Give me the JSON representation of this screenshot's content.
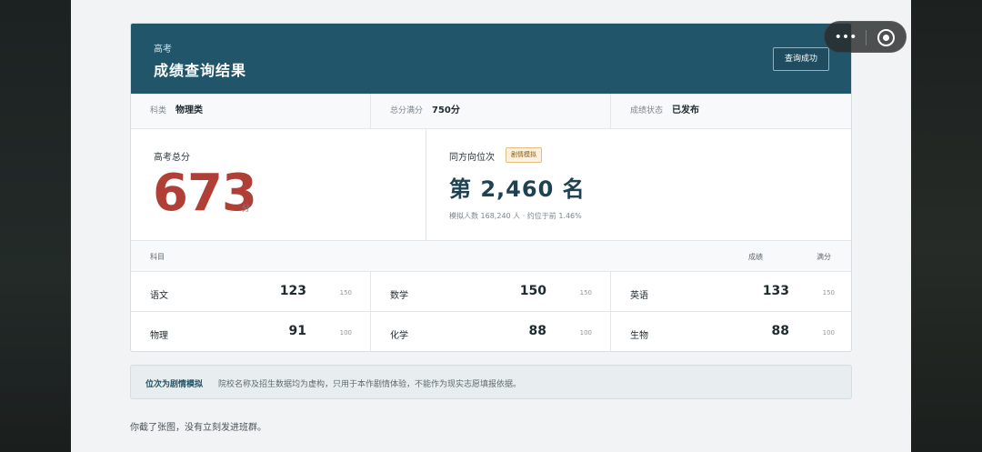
{
  "header": {
    "eyebrow": "高考",
    "title": "成绩查询结果",
    "status_button": "查询成功"
  },
  "info": [
    {
      "key": "科类",
      "value": "物理类"
    },
    {
      "key": "总分满分",
      "value": "750分"
    },
    {
      "key": "成绩状态",
      "value": "已发布"
    }
  ],
  "score": {
    "label": "高考总分",
    "value": "673",
    "unit": "分"
  },
  "rank": {
    "label": "同方向位次",
    "badge": "剧情模拟",
    "value": "第 2,460 名",
    "note": "模拟人数 168,240 人 · 约位于前 1.46%"
  },
  "subjects_header": {
    "subject": "科目",
    "score": "成绩",
    "full": "满分"
  },
  "subjects": [
    {
      "name": "语文",
      "score": "123",
      "full": "150"
    },
    {
      "name": "数学",
      "score": "150",
      "full": "150"
    },
    {
      "name": "英语",
      "score": "133",
      "full": "150"
    },
    {
      "name": "物理",
      "score": "91",
      "full": "100"
    },
    {
      "name": "化学",
      "score": "88",
      "full": "100"
    },
    {
      "name": "生物",
      "score": "88",
      "full": "100"
    }
  ],
  "notice": {
    "title": "位次为剧情模拟",
    "body": "院校名称及招生数据均为虚构，只用于本作剧情体验，不能作为现实志愿填报依据。"
  },
  "footer_text": "你截了张图，没有立刻发进班群。",
  "capsule": {
    "menu_icon": "more-dots-icon",
    "close_icon": "target-circle-icon",
    "menu_glyph": "•••"
  },
  "colors": {
    "header_bg": "#215569",
    "score_red": "#b03f37",
    "rank_navy": "#1f4252",
    "badge_bg": "#fbf1de"
  }
}
